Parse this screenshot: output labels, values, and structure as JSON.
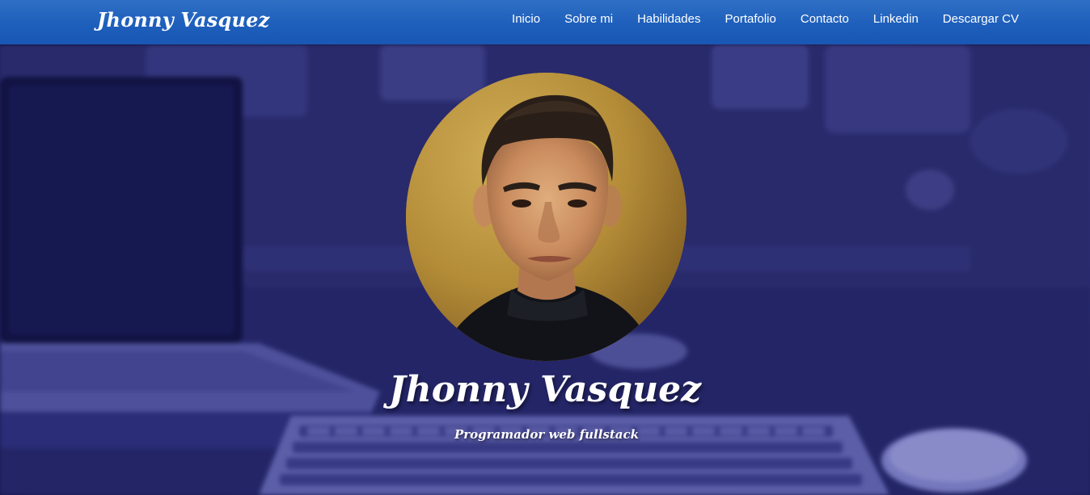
{
  "navbar": {
    "brand": "Jhonny Vasquez",
    "links": [
      {
        "label": "Inicio"
      },
      {
        "label": "Sobre mi"
      },
      {
        "label": "Habilidades"
      },
      {
        "label": "Portafolio"
      },
      {
        "label": "Contacto"
      },
      {
        "label": "Linkedin"
      },
      {
        "label": "Descargar CV"
      }
    ]
  },
  "hero": {
    "name": "Jhonny Vasquez",
    "subtitle": "Programador web fullstack"
  },
  "colors": {
    "navbar": "#1e5fbc",
    "hero_overlay": "#2a2b6e",
    "text": "#ffffff"
  }
}
